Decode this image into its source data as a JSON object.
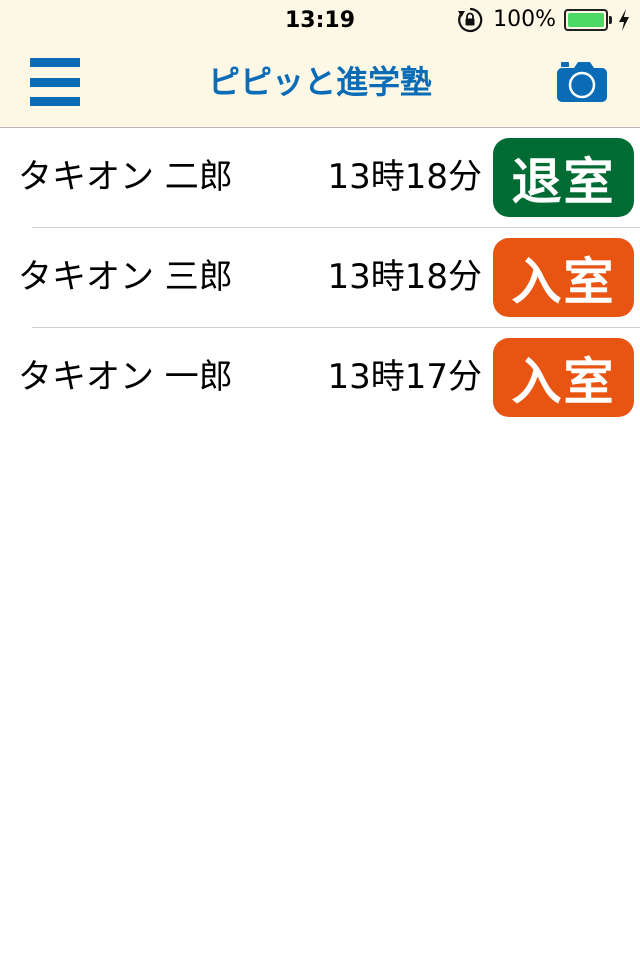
{
  "status_bar": {
    "time": "13:19",
    "battery_percent": "100%",
    "battery_level": 1.0,
    "icons": [
      "rotation-lock-icon",
      "battery-icon",
      "charging-bolt-icon"
    ]
  },
  "nav": {
    "title": "ピピッと進学塾",
    "menu_icon": "hamburger-menu-icon",
    "camera_icon": "camera-icon",
    "accent_color": "#0a6bb6",
    "background_color": "#fdf7e6"
  },
  "records": [
    {
      "name": "タキオン 二郎",
      "time": "13時18分",
      "status": "退室",
      "status_color": "#006b33"
    },
    {
      "name": "タキオン 三郎",
      "time": "13時18分",
      "status": "入室",
      "status_color": "#e85512"
    },
    {
      "name": "タキオン 一郎",
      "time": "13時17分",
      "status": "入室",
      "status_color": "#e85512"
    }
  ]
}
